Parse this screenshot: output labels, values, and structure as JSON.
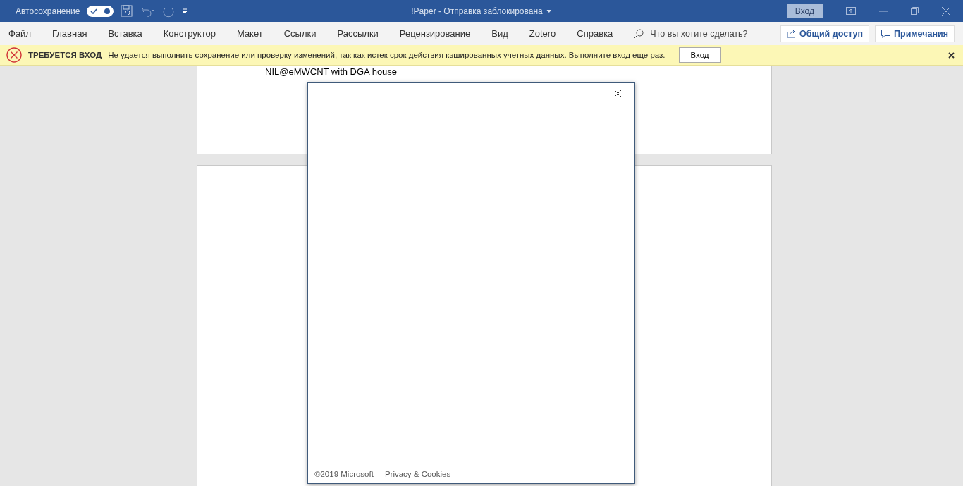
{
  "title_bar": {
    "autosave_label": "Автосохранение",
    "autosave_on": true,
    "document_title": "!Paper  -  Отправка заблокирована",
    "sign_in": "Вход"
  },
  "menu": {
    "tabs": [
      "Файл",
      "Главная",
      "Вставка",
      "Конструктор",
      "Макет",
      "Ссылки",
      "Рассылки",
      "Рецензирование",
      "Вид",
      "Zotero",
      "Справка"
    ],
    "search_placeholder": "Что вы хотите сделать?",
    "share": "Общий доступ",
    "comments": "Примечания"
  },
  "banner": {
    "title": "ТРЕБУЕТСЯ ВХОД",
    "message": "Не удается выполнить сохранение или проверку изменений, так как истек срок действия кэшированных учетных данных. Выполните вход еще раз.",
    "button": "Вход"
  },
  "document": {
    "visible_line": "NIL@eMWCNT with DGA house"
  },
  "dialog": {
    "footer_copyright": "©2019 Microsoft",
    "footer_link": "Privacy & Cookies"
  }
}
